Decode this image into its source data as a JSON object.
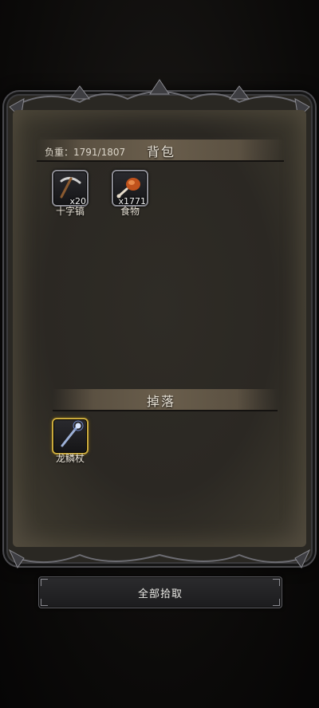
{
  "bag": {
    "weight_label": "负重：1791/1807",
    "title": "背包",
    "items": [
      {
        "name": "十字镐",
        "count": "x20",
        "icon": "pickaxe-icon"
      },
      {
        "name": "食物",
        "count": "x1771",
        "icon": "meat-icon"
      }
    ]
  },
  "drops": {
    "title": "掉落",
    "items": [
      {
        "name": "龙鳞杖",
        "count": "",
        "icon": "staff-icon"
      }
    ]
  },
  "actions": {
    "pickup_all_label": "全部拾取"
  },
  "colors": {
    "panel_bg": "#2b2823",
    "section_bar": "#6a5e4c",
    "slot_border": "#8a8a92",
    "drop_slot_border": "#c9a93c",
    "text": "#ece6da"
  }
}
